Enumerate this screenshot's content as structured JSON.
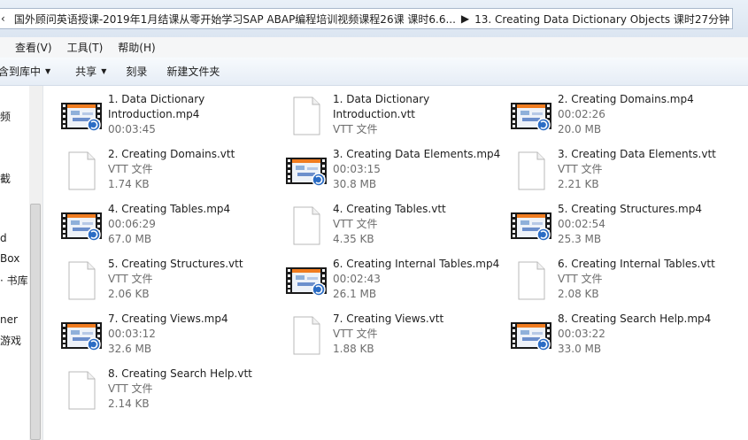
{
  "address": {
    "back": "‹",
    "crumbs": [
      "国外顾问英语授课-2019年1月结课从零开始学习SAP ABAP编程培训视频课程26课 课时6.6...",
      "13. Creating Data Dictionary Objects 课时27分钟"
    ]
  },
  "menu": [
    "查看(V)",
    "工具(T)",
    "帮助(H)"
  ],
  "toolbar": {
    "include": "含到库中",
    "share": "共享",
    "burn": "刻录",
    "newfolder": "新建文件夹"
  },
  "nav": [
    "频",
    "截",
    "d",
    "Box",
    "· 书库",
    "ner",
    "游戏"
  ],
  "files": [
    {
      "name1": "1. Data Dictionary",
      "name2": "Introduction.mp4",
      "sub1": "00:03:45",
      "sub2": "",
      "kind": "video"
    },
    {
      "name1": "1. Data Dictionary",
      "name2": "Introduction.vtt",
      "sub1": "VTT 文件",
      "sub2": "",
      "kind": "doc"
    },
    {
      "name1": "2. Creating Domains.mp4",
      "name2": "",
      "sub1": "00:02:26",
      "sub2": "20.0 MB",
      "kind": "video"
    },
    {
      "name1": "2. Creating Domains.vtt",
      "name2": "",
      "sub1": "VTT 文件",
      "sub2": "1.74 KB",
      "kind": "doc"
    },
    {
      "name1": "3. Creating Data Elements.mp4",
      "name2": "",
      "sub1": "00:03:15",
      "sub2": "30.8 MB",
      "kind": "video"
    },
    {
      "name1": "3. Creating Data Elements.vtt",
      "name2": "",
      "sub1": "VTT 文件",
      "sub2": "2.21 KB",
      "kind": "doc"
    },
    {
      "name1": "4. Creating Tables.mp4",
      "name2": "",
      "sub1": "00:06:29",
      "sub2": "67.0 MB",
      "kind": "video"
    },
    {
      "name1": "4. Creating Tables.vtt",
      "name2": "",
      "sub1": "VTT 文件",
      "sub2": "4.35 KB",
      "kind": "doc"
    },
    {
      "name1": "5. Creating Structures.mp4",
      "name2": "",
      "sub1": "00:02:54",
      "sub2": "25.3 MB",
      "kind": "video"
    },
    {
      "name1": "5. Creating Structures.vtt",
      "name2": "",
      "sub1": "VTT 文件",
      "sub2": "2.06 KB",
      "kind": "doc"
    },
    {
      "name1": "6. Creating Internal Tables.mp4",
      "name2": "",
      "sub1": "00:02:43",
      "sub2": "26.1 MB",
      "kind": "video"
    },
    {
      "name1": "6. Creating Internal Tables.vtt",
      "name2": "",
      "sub1": "VTT 文件",
      "sub2": "2.08 KB",
      "kind": "doc"
    },
    {
      "name1": "7. Creating Views.mp4",
      "name2": "",
      "sub1": "00:03:12",
      "sub2": "32.6 MB",
      "kind": "video"
    },
    {
      "name1": "7. Creating Views.vtt",
      "name2": "",
      "sub1": "VTT 文件",
      "sub2": "1.88 KB",
      "kind": "doc"
    },
    {
      "name1": "8. Creating Search Help.mp4",
      "name2": "",
      "sub1": "00:03:22",
      "sub2": "33.0 MB",
      "kind": "video"
    },
    {
      "name1": "8. Creating Search Help.vtt",
      "name2": "",
      "sub1": "VTT 文件",
      "sub2": "2.14 KB",
      "kind": "doc"
    }
  ],
  "colors": {
    "accent": "#2b6cc4",
    "video_bar": "#f07c20"
  }
}
